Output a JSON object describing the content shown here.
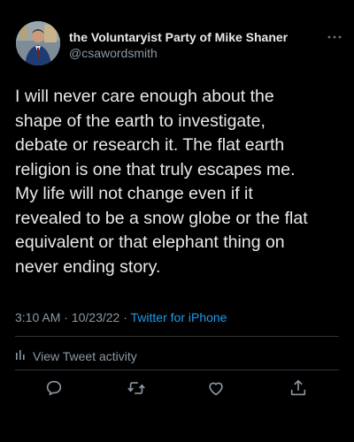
{
  "tweet": {
    "display_name": "the Voluntaryist Party of Mike Shaner",
    "handle": "@csawordsmith",
    "text": "I will never care enough about the\nshape of the earth to investigate,\ndebate or research it. The flat earth\nreligion is one that truly escapes me.\nMy life will not change even if it\nrevealed to be a snow globe or the flat\nequivalent or that elephant thing on\nnever ending story.",
    "time": "3:10 AM",
    "date": "10/23/22",
    "separator": "·",
    "source": "Twitter for iPhone"
  },
  "activity": {
    "label": "View Tweet activity"
  },
  "actions": {
    "reply": "reply-icon",
    "retweet": "retweet-icon",
    "like": "heart-icon",
    "share": "share-icon"
  },
  "colors": {
    "background": "#000000",
    "text": "#e7e9ea",
    "secondary": "#8b98a5",
    "accent": "#1d9bf0"
  }
}
